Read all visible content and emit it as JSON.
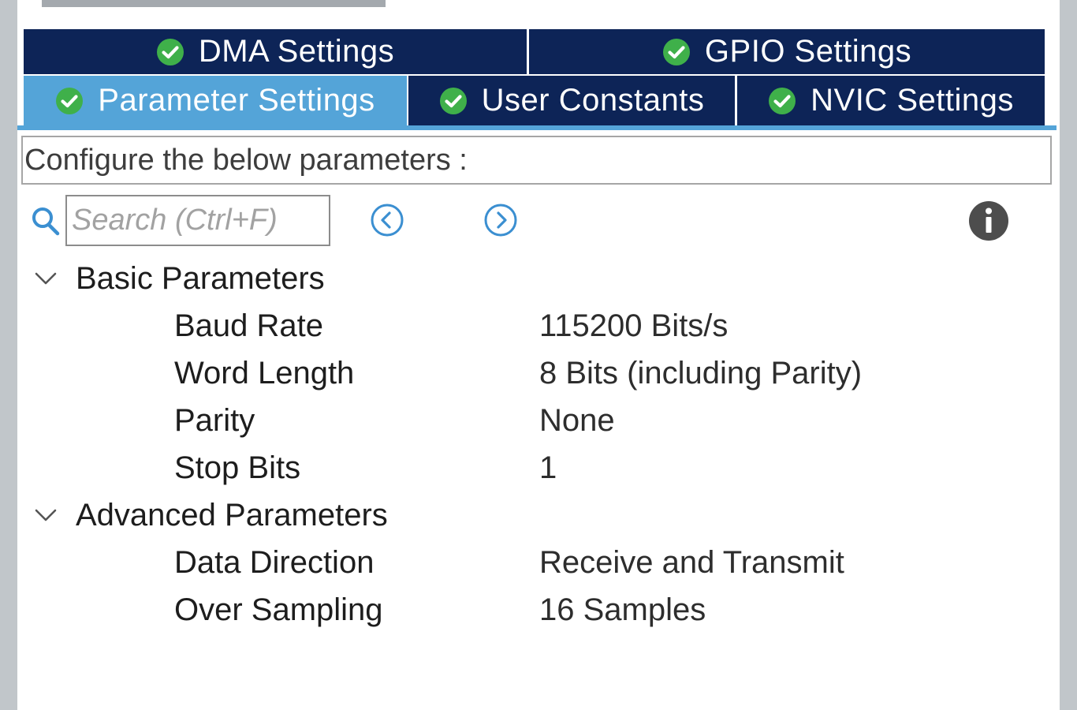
{
  "tabs": {
    "row1": [
      {
        "label": "DMA Settings",
        "icon": "check-circle-icon",
        "active": false
      },
      {
        "label": "GPIO Settings",
        "icon": "check-circle-icon",
        "active": false
      }
    ],
    "row2": [
      {
        "label": "Parameter Settings",
        "icon": "check-circle-icon",
        "active": true
      },
      {
        "label": "User Constants",
        "icon": "check-circle-icon",
        "active": false
      },
      {
        "label": "NVIC Settings",
        "icon": "check-circle-icon",
        "active": false
      }
    ]
  },
  "config_header": "Configure the below parameters :",
  "search": {
    "placeholder": "Search (Ctrl+F)",
    "value": ""
  },
  "toolbar": {
    "prev_icon": "circle-chevron-left-icon",
    "next_icon": "circle-chevron-right-icon",
    "info_icon": "info-icon"
  },
  "groups": [
    {
      "title": "Basic Parameters",
      "expanded": true,
      "params": [
        {
          "name": "Baud Rate",
          "value": "115200 Bits/s"
        },
        {
          "name": "Word Length",
          "value": "8 Bits (including Parity)"
        },
        {
          "name": "Parity",
          "value": "None"
        },
        {
          "name": "Stop Bits",
          "value": "1"
        }
      ]
    },
    {
      "title": "Advanced Parameters",
      "expanded": true,
      "params": [
        {
          "name": "Data Direction",
          "value": "Receive and Transmit"
        },
        {
          "name": "Over Sampling",
          "value": "16 Samples"
        }
      ]
    }
  ],
  "colors": {
    "tab_bg": "#0d2457",
    "tab_active_bg": "#54a4d8",
    "check_green": "#3fb04a",
    "nav_blue": "#3b8fd1"
  }
}
